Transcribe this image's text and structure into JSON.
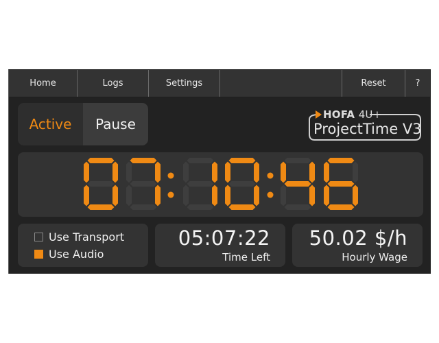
{
  "menu": {
    "home": "Home",
    "logs": "Logs",
    "settings": "Settings",
    "reset": "Reset",
    "help": "?"
  },
  "mode_toggle": {
    "active_label": "Active",
    "pause_label": "Pause",
    "selected": "Active"
  },
  "logo": {
    "brand": "HOFA",
    "brand_suffix": "4U+",
    "product": "ProjectTime V3"
  },
  "main_timer": {
    "value": "07:10:46"
  },
  "options": {
    "use_transport": {
      "label": "Use Transport",
      "checked": false
    },
    "use_audio": {
      "label": "Use Audio",
      "checked": true
    }
  },
  "time_left": {
    "value": "05:07:22",
    "label": "Time Left"
  },
  "hourly_wage": {
    "value": "50.02 $/h",
    "label": "Hourly Wage"
  },
  "colors": {
    "accent": "#f08a14",
    "segment_off": "#3e3e3e",
    "background": "#222222",
    "panel": "#333333"
  }
}
